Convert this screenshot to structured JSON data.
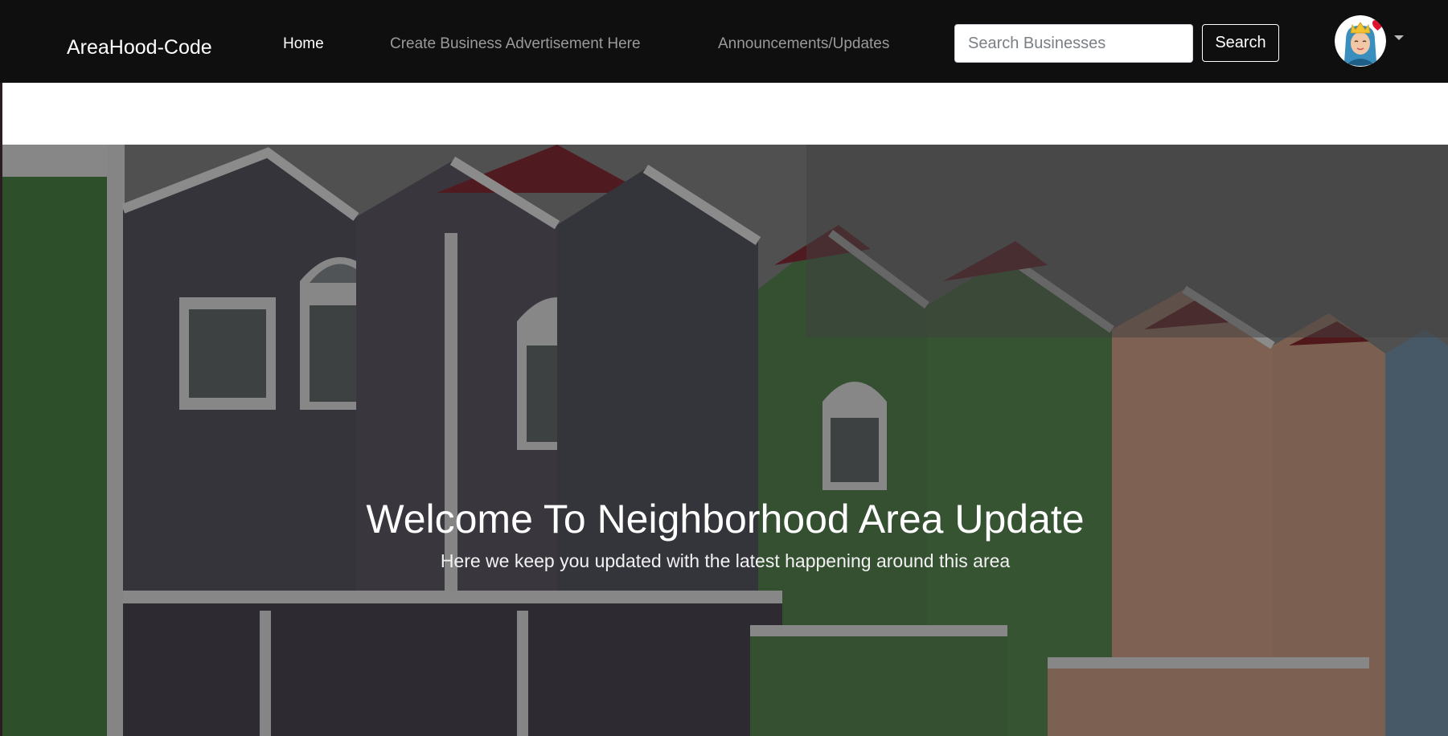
{
  "navbar": {
    "brand": "AreaHood-Code",
    "links": [
      {
        "label": "Home",
        "active": true
      },
      {
        "label": "Create Business Advertisement Here",
        "active": false
      },
      {
        "label": "Announcements/Updates",
        "active": false
      }
    ],
    "search": {
      "placeholder": "Search Businesses",
      "value": "",
      "button_label": "Search"
    },
    "user_menu": {
      "avatar_icon": "user-avatar-icon",
      "dropdown_icon": "caret-down-icon"
    }
  },
  "hero": {
    "title": "Welcome To Neighborhood Area Update",
    "subtitle": "Here we keep you updated with the latest happening around this area",
    "background_image": "row-of-colorful-townhouses"
  },
  "colors": {
    "navbar_bg": "#0f0f10",
    "nav_link": "#9a9a9a",
    "nav_link_active": "#ffffff",
    "hero_text": "#ffffff"
  }
}
